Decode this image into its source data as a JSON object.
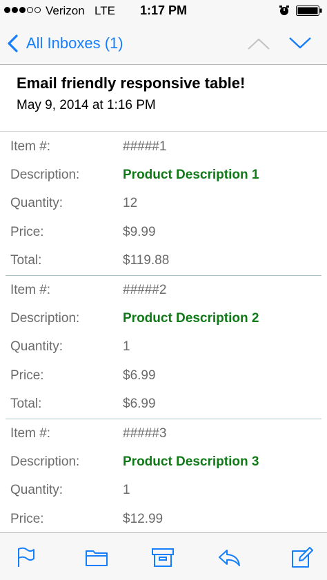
{
  "status_bar": {
    "carrier": "Verizon",
    "network": "LTE",
    "time": "1:17 PM",
    "signal_dots_filled": 3,
    "signal_dots_total": 5
  },
  "nav": {
    "back_label": "All Inboxes (1)",
    "prev_icon": "chevron-up-icon",
    "next_icon": "chevron-down-icon",
    "accent_color": "#157efb"
  },
  "email": {
    "subject": "Email friendly responsive table!",
    "date": "May 9, 2014 at 1:16 PM"
  },
  "items": [
    {
      "rows": [
        {
          "label": "Item #:",
          "value": "#####1"
        },
        {
          "label": "Description:",
          "value": "Product Description 1",
          "highlight": true
        },
        {
          "label": "Quantity:",
          "value": "12"
        },
        {
          "label": "Price:",
          "value": "$9.99"
        },
        {
          "label": "Total:",
          "value": "$119.88"
        }
      ]
    },
    {
      "rows": [
        {
          "label": "Item #:",
          "value": "#####2"
        },
        {
          "label": "Description:",
          "value": "Product Description 2",
          "highlight": true
        },
        {
          "label": "Quantity:",
          "value": "1"
        },
        {
          "label": "Price:",
          "value": "$6.99"
        },
        {
          "label": "Total:",
          "value": "$6.99"
        }
      ]
    },
    {
      "rows": [
        {
          "label": "Item #:",
          "value": "#####3"
        },
        {
          "label": "Description:",
          "value": "Product Description 3",
          "highlight": true
        },
        {
          "label": "Quantity:",
          "value": "1"
        },
        {
          "label": "Price:",
          "value": "$12.99"
        }
      ]
    }
  ],
  "colors": {
    "description_green": "#0f7a16",
    "label_gray": "#6b6b6b"
  },
  "toolbar": {
    "icons": [
      "flag-icon",
      "folder-icon",
      "archive-icon",
      "reply-icon",
      "compose-icon"
    ]
  }
}
